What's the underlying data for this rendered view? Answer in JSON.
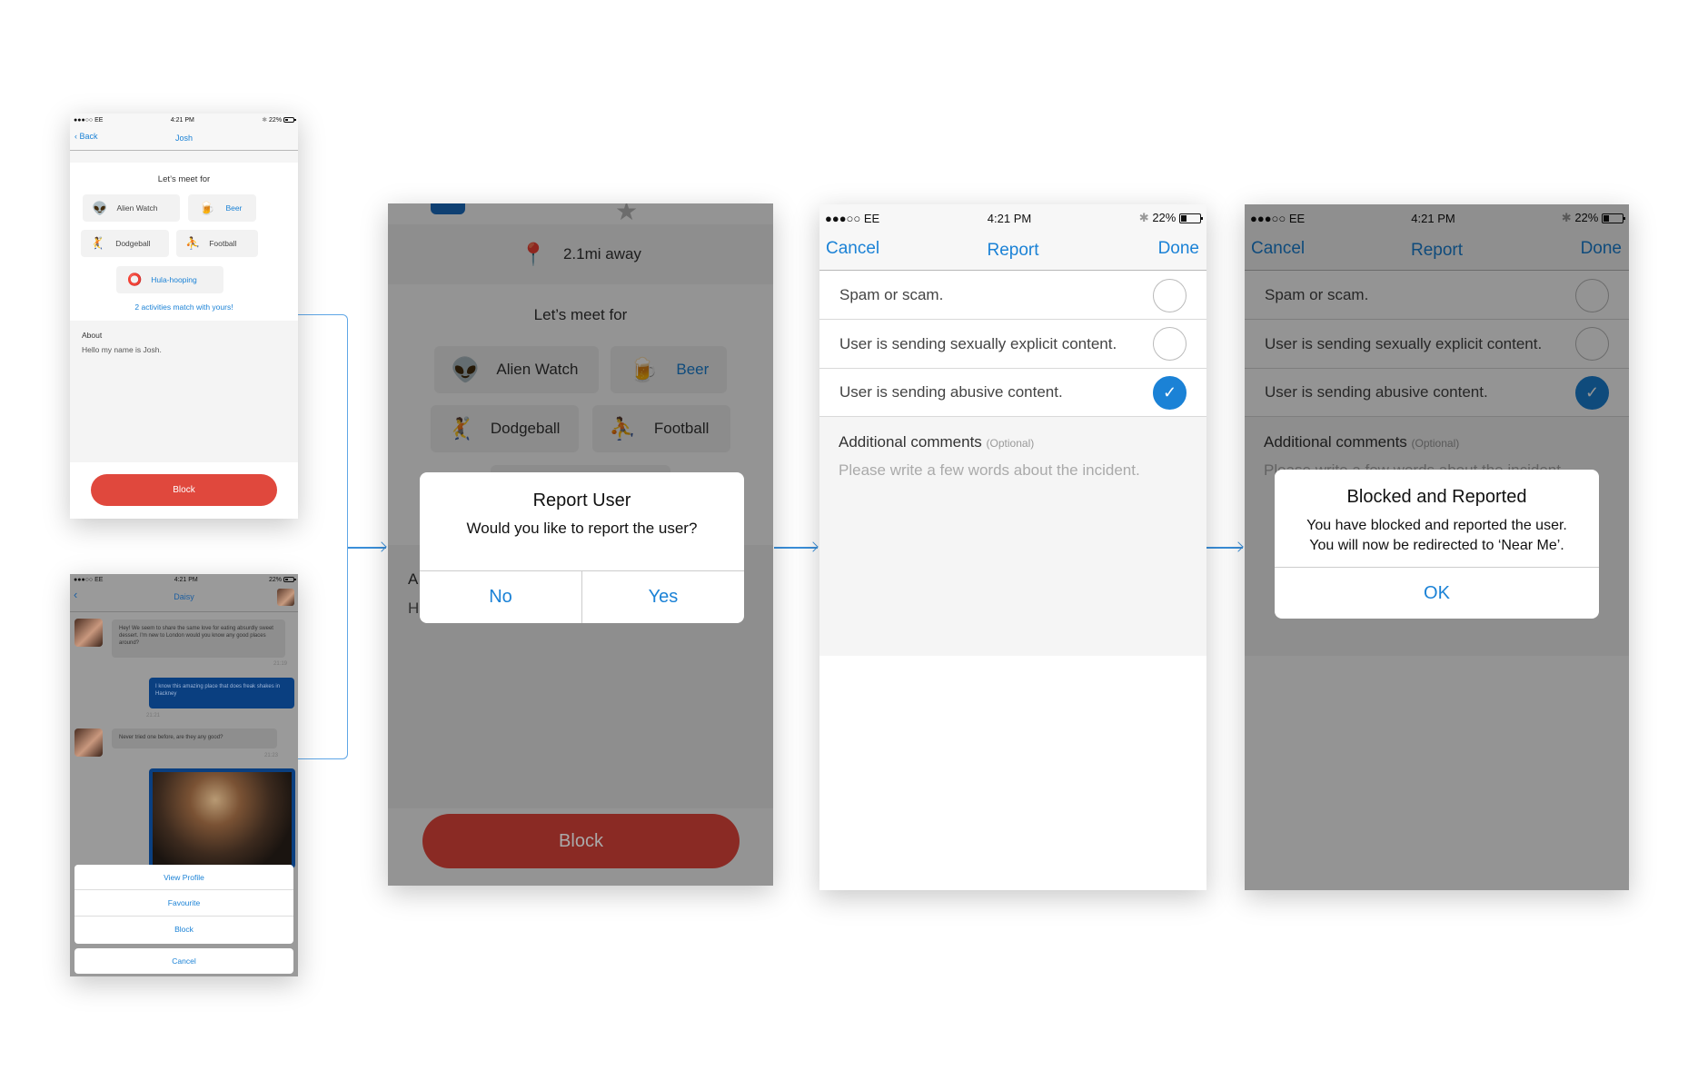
{
  "status_bar": {
    "carrier": "●●●○○ EE",
    "time": "4:21 PM",
    "battery": "22%"
  },
  "colors": {
    "accent": "#1b82d6",
    "block_red": "#e0483d",
    "chat_blue": "#0a4ea3",
    "pin_green": "#2e9a55"
  },
  "screen1": {
    "back_label": "Back",
    "title": "Josh",
    "meet_heading": "Let’s meet for",
    "activities": [
      {
        "label": "Alien Watch",
        "icon": "alien-icon",
        "matched": false
      },
      {
        "label": "Beer",
        "icon": "beer-icon",
        "matched": true
      },
      {
        "label": "Dodgeball",
        "icon": "dodgeball-icon",
        "matched": false
      },
      {
        "label": "Football",
        "icon": "football-icon",
        "matched": false
      },
      {
        "label": "Hula-hooping",
        "icon": "hula-hoop-icon",
        "matched": true
      }
    ],
    "match_text": "2 activities match with yours!",
    "about_label": "About",
    "about_text": "Hello my name is Josh.",
    "block_label": "Block"
  },
  "screen_chat": {
    "title": "Daisy",
    "messages": [
      {
        "from": "them",
        "text": "Hey! We seem to share the same love for eating absurdly sweet dessert. I'm new to London would you know any good places around?",
        "time": "21:19"
      },
      {
        "from": "me",
        "text": "I know this amazing place that does freak shakes in Hackney",
        "time": "21:21"
      },
      {
        "from": "them",
        "text": "Never tried one before, are they any good?",
        "time": "21:23"
      }
    ],
    "action_sheet": [
      "View Profile",
      "Favourite",
      "Block"
    ],
    "cancel_label": "Cancel"
  },
  "screen2": {
    "distance": "2.1mi away",
    "meet_heading": "Let’s meet for",
    "activities": [
      "Alien Watch",
      "Beer",
      "Dodgeball",
      "Football"
    ],
    "block_label": "Block",
    "dialog": {
      "title": "Report User",
      "message": "Would you like to report the user?",
      "no_label": "No",
      "yes_label": "Yes"
    }
  },
  "screen3": {
    "cancel_label": "Cancel",
    "title": "Report",
    "done_label": "Done",
    "options": [
      {
        "label": "Spam or scam.",
        "checked": false
      },
      {
        "label": "User is sending sexually explicit content.",
        "checked": false
      },
      {
        "label": "User is sending abusive content.",
        "checked": true
      }
    ],
    "comments_label": "Additional comments",
    "comments_optional": "(Optional)",
    "comments_placeholder": "Please write a few words about the incident."
  },
  "screen4": {
    "dialog": {
      "title": "Blocked and Reported",
      "line1": "You have blocked and reported the user.",
      "line2": "You will now be redirected to ‘Near Me’.",
      "ok_label": "OK"
    }
  }
}
